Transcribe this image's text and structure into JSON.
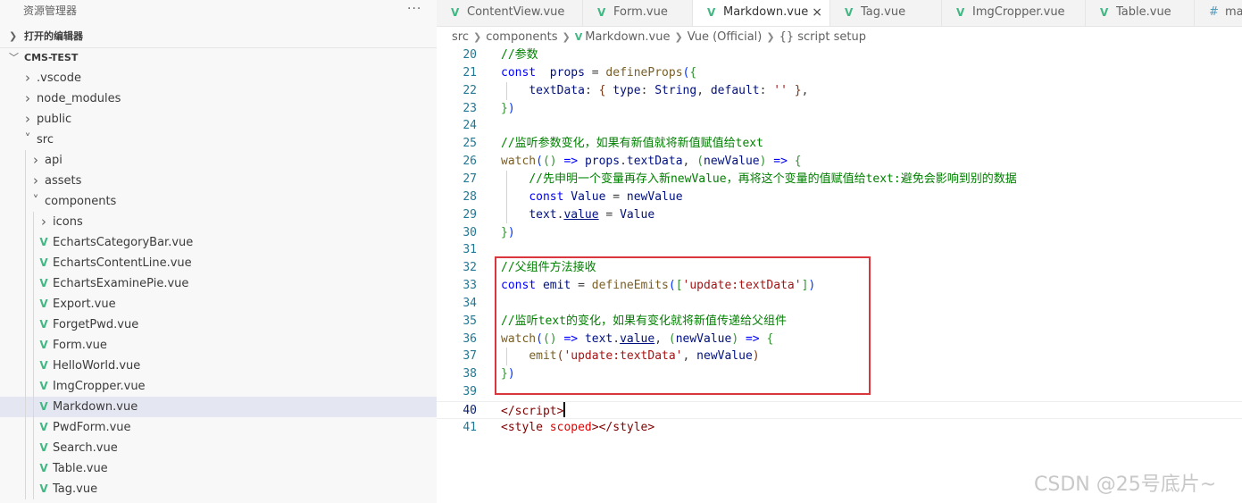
{
  "sidebar": {
    "title": "资源管理器",
    "more_icon": "···",
    "open_editors_label": "打开的编辑器",
    "project_label": "CMS-TEST",
    "tree": [
      {
        "label": ".vscode",
        "type": "folder",
        "depth": 1,
        "expanded": false
      },
      {
        "label": "node_modules",
        "type": "folder",
        "depth": 1,
        "expanded": false
      },
      {
        "label": "public",
        "type": "folder",
        "depth": 1,
        "expanded": false
      },
      {
        "label": "src",
        "type": "folder",
        "depth": 1,
        "expanded": true
      },
      {
        "label": "api",
        "type": "folder",
        "depth": 2,
        "expanded": false
      },
      {
        "label": "assets",
        "type": "folder",
        "depth": 2,
        "expanded": false
      },
      {
        "label": "components",
        "type": "folder",
        "depth": 2,
        "expanded": true
      },
      {
        "label": "icons",
        "type": "folder",
        "depth": 3,
        "expanded": false
      },
      {
        "label": "EchartsCategoryBar.vue",
        "type": "vue",
        "depth": 3
      },
      {
        "label": "EchartsContentLine.vue",
        "type": "vue",
        "depth": 3
      },
      {
        "label": "EchartsExaminePie.vue",
        "type": "vue",
        "depth": 3
      },
      {
        "label": "Export.vue",
        "type": "vue",
        "depth": 3
      },
      {
        "label": "ForgetPwd.vue",
        "type": "vue",
        "depth": 3
      },
      {
        "label": "Form.vue",
        "type": "vue",
        "depth": 3
      },
      {
        "label": "HelloWorld.vue",
        "type": "vue",
        "depth": 3
      },
      {
        "label": "ImgCropper.vue",
        "type": "vue",
        "depth": 3
      },
      {
        "label": "Markdown.vue",
        "type": "vue",
        "depth": 3,
        "selected": true
      },
      {
        "label": "PwdForm.vue",
        "type": "vue",
        "depth": 3
      },
      {
        "label": "Search.vue",
        "type": "vue",
        "depth": 3
      },
      {
        "label": "Table.vue",
        "type": "vue",
        "depth": 3
      },
      {
        "label": "Tag.vue",
        "type": "vue",
        "depth": 3
      }
    ]
  },
  "tabs": [
    {
      "label": "ContentView.vue",
      "icon": "vue-icon"
    },
    {
      "label": "Form.vue",
      "icon": "vue-icon"
    },
    {
      "label": "Markdown.vue",
      "icon": "vue-icon",
      "active": true,
      "close": "×"
    },
    {
      "label": "Tag.vue",
      "icon": "vue-icon"
    },
    {
      "label": "ImgCropper.vue",
      "icon": "vue-icon"
    },
    {
      "label": "Table.vue",
      "icon": "vue-icon"
    },
    {
      "label": "ma",
      "icon": "css-hash-icon"
    }
  ],
  "breadcrumb": {
    "src": "src",
    "components": "components",
    "file": "Markdown.vue",
    "lang": "Vue (Official)",
    "symbol_icon": "{}",
    "symbol": "script setup"
  },
  "editor": {
    "current_line": 40,
    "lines": [
      {
        "n": 20,
        "tokens": [
          [
            "cm",
            "//参数"
          ]
        ]
      },
      {
        "n": 21,
        "tokens": [
          [
            "kw",
            "const"
          ],
          [
            "",
            "  "
          ],
          [
            "vr",
            "props"
          ],
          [
            "",
            " = "
          ],
          [
            "fn",
            "defineProps"
          ],
          [
            "b1",
            "("
          ],
          [
            "b2",
            "{"
          ]
        ]
      },
      {
        "n": 22,
        "tokens": [
          [
            "",
            "    "
          ],
          [
            "vr",
            "textData"
          ],
          [
            "",
            ": "
          ],
          [
            "b3",
            "{"
          ],
          [
            "",
            " "
          ],
          [
            "vr",
            "type"
          ],
          [
            "",
            ": "
          ],
          [
            "vr",
            "String"
          ],
          [
            "",
            ", "
          ],
          [
            "vr",
            "default"
          ],
          [
            "",
            ": "
          ],
          [
            "st",
            "''"
          ],
          [
            "",
            " "
          ],
          [
            "b3",
            "}"
          ],
          [
            "",
            ","
          ]
        ]
      },
      {
        "n": 23,
        "tokens": [
          [
            "b2",
            "}"
          ],
          [
            "b1",
            ")"
          ]
        ]
      },
      {
        "n": 24,
        "tokens": []
      },
      {
        "n": 25,
        "tokens": [
          [
            "cm",
            "//监听参数变化，如果有新值就将新值赋值给text"
          ]
        ]
      },
      {
        "n": 26,
        "tokens": [
          [
            "fn",
            "watch"
          ],
          [
            "b1",
            "("
          ],
          [
            "b2",
            "("
          ],
          [
            "b2",
            ")"
          ],
          [
            "",
            " "
          ],
          [
            "kw",
            "=>"
          ],
          [
            "",
            " "
          ],
          [
            "vr",
            "props"
          ],
          [
            "",
            "."
          ],
          [
            "vr",
            "textData"
          ],
          [
            "",
            ", "
          ],
          [
            "b2",
            "("
          ],
          [
            "vr",
            "newValue"
          ],
          [
            "b2",
            ")"
          ],
          [
            "",
            " "
          ],
          [
            "kw",
            "=>"
          ],
          [
            "",
            " "
          ],
          [
            "b2",
            "{"
          ]
        ]
      },
      {
        "n": 27,
        "tokens": [
          [
            "",
            "    "
          ],
          [
            "cm",
            "//先申明一个变量再存入新newValue，再将这个变量的值赋值给text:避免会影响到别的数据"
          ]
        ]
      },
      {
        "n": 28,
        "tokens": [
          [
            "",
            "    "
          ],
          [
            "kw",
            "const"
          ],
          [
            "",
            " "
          ],
          [
            "vr",
            "Value"
          ],
          [
            "",
            " = "
          ],
          [
            "vr",
            "newValue"
          ]
        ]
      },
      {
        "n": 29,
        "tokens": [
          [
            "",
            "    "
          ],
          [
            "vr",
            "text"
          ],
          [
            "",
            "."
          ],
          [
            "vr ul",
            "value"
          ],
          [
            "",
            " = "
          ],
          [
            "vr",
            "Value"
          ]
        ]
      },
      {
        "n": 30,
        "tokens": [
          [
            "b2",
            "}"
          ],
          [
            "b1",
            ")"
          ]
        ]
      },
      {
        "n": 31,
        "tokens": []
      },
      {
        "n": 32,
        "tokens": [
          [
            "cm",
            "//父组件方法接收"
          ]
        ]
      },
      {
        "n": 33,
        "tokens": [
          [
            "kw",
            "const"
          ],
          [
            "",
            " "
          ],
          [
            "vr",
            "emit"
          ],
          [
            "",
            " = "
          ],
          [
            "fn",
            "defineEmits"
          ],
          [
            "b1",
            "("
          ],
          [
            "b2",
            "["
          ],
          [
            "st",
            "'update:textData'"
          ],
          [
            "b2",
            "]"
          ],
          [
            "b1",
            ")"
          ]
        ]
      },
      {
        "n": 34,
        "tokens": []
      },
      {
        "n": 35,
        "tokens": [
          [
            "cm",
            "//监听text的变化，如果有变化就将新值传递给父组件"
          ]
        ]
      },
      {
        "n": 36,
        "tokens": [
          [
            "fn",
            "watch"
          ],
          [
            "b1",
            "("
          ],
          [
            "b2",
            "("
          ],
          [
            "b2",
            ")"
          ],
          [
            "",
            " "
          ],
          [
            "kw",
            "=>"
          ],
          [
            "",
            " "
          ],
          [
            "vr",
            "text"
          ],
          [
            "",
            "."
          ],
          [
            "vr ul",
            "value"
          ],
          [
            "",
            ", "
          ],
          [
            "b2",
            "("
          ],
          [
            "vr",
            "newValue"
          ],
          [
            "b2",
            ")"
          ],
          [
            "",
            " "
          ],
          [
            "kw",
            "=>"
          ],
          [
            "",
            " "
          ],
          [
            "b2",
            "{"
          ]
        ]
      },
      {
        "n": 37,
        "tokens": [
          [
            "",
            "    "
          ],
          [
            "fn",
            "emit"
          ],
          [
            "b3",
            "("
          ],
          [
            "st",
            "'update:textData'"
          ],
          [
            "",
            ", "
          ],
          [
            "vr",
            "newValue"
          ],
          [
            "b3",
            ")"
          ]
        ]
      },
      {
        "n": 38,
        "tokens": [
          [
            "b2",
            "}"
          ],
          [
            "b1",
            ")"
          ]
        ]
      },
      {
        "n": 39,
        "tokens": []
      },
      {
        "n": 40,
        "tokens": [
          [
            "tg",
            "</"
          ],
          [
            "tg",
            "script"
          ],
          [
            "tg",
            ">"
          ]
        ],
        "caret": true
      },
      {
        "n": 41,
        "tokens": [
          [
            "tg",
            "<"
          ],
          [
            "tg",
            "style"
          ],
          [
            "",
            " "
          ],
          [
            "at",
            "scoped"
          ],
          [
            "tg",
            "></"
          ],
          [
            "tg",
            "style"
          ],
          [
            "tg",
            ">"
          ]
        ]
      }
    ]
  },
  "watermark": "CSDN @25号底片~",
  "colors": {
    "vue_green": "#41b883",
    "selection": "#e4e6f1",
    "highlight_box": "#d9363e",
    "line_number": "#237893"
  }
}
